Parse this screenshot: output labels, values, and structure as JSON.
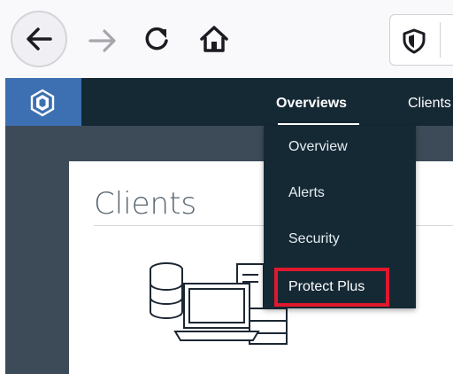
{
  "browser": {
    "icons": {
      "back": "arrow-left-icon",
      "forward": "arrow-right-icon",
      "reload": "reload-icon",
      "home": "home-icon",
      "tracking": "shield-icon"
    }
  },
  "app": {
    "logo_icon": "app-logo-icon",
    "nav": {
      "overviews_label": "Overviews",
      "clients_label": "Clients"
    },
    "dropdown": {
      "items": [
        {
          "label": "Overview"
        },
        {
          "label": "Alerts"
        },
        {
          "label": "Security"
        },
        {
          "label": "Protect Plus",
          "highlighted": true
        }
      ]
    },
    "page": {
      "title": "Clients"
    }
  },
  "colors": {
    "nav_bg": "#152935",
    "logo_bg": "#3d70b2",
    "subbar_bg": "#3d4b58",
    "highlight_border": "#e0182d",
    "title_text": "#5a6872"
  }
}
